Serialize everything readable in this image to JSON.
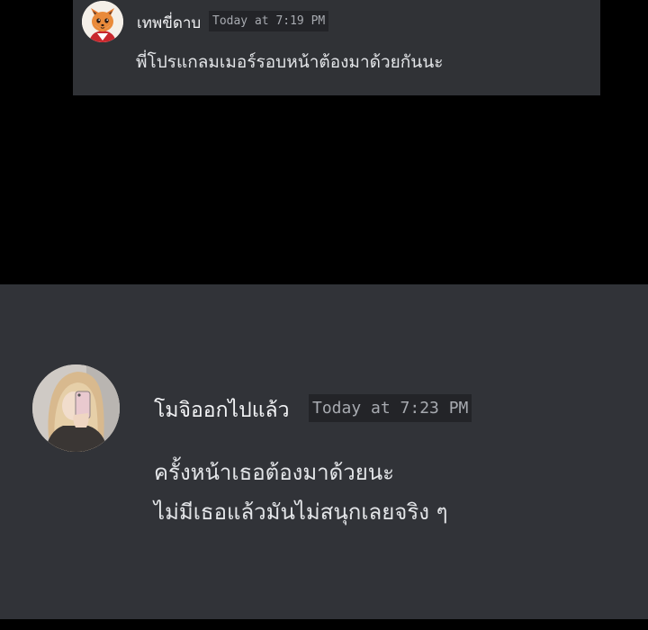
{
  "colors": {
    "page_background": "#000000",
    "message_background": "#313338",
    "timestamp_background": "#232428",
    "username_text": "#f2f3f5",
    "timestamp_text": "#a7aab0",
    "message_text": "#e3e5e8"
  },
  "messages": [
    {
      "avatar": "fox-avatar",
      "username": "เทพขี่ดาบ",
      "timestamp": "Today at 7:19 PM",
      "lines": [
        "พี่โปรแกลมเมอร์รอบหน้าต้องมาด้วยกันนะ"
      ]
    },
    {
      "avatar": "blonde-girl-selfie-avatar",
      "username": "โมจิออกไปแล้ว",
      "timestamp": "Today at 7:23 PM",
      "lines": [
        "ครั้งหน้าเธอต้องมาด้วยนะ",
        "ไม่มีเธอแล้วมันไม่สนุกเลยจริง ๆ"
      ]
    }
  ]
}
